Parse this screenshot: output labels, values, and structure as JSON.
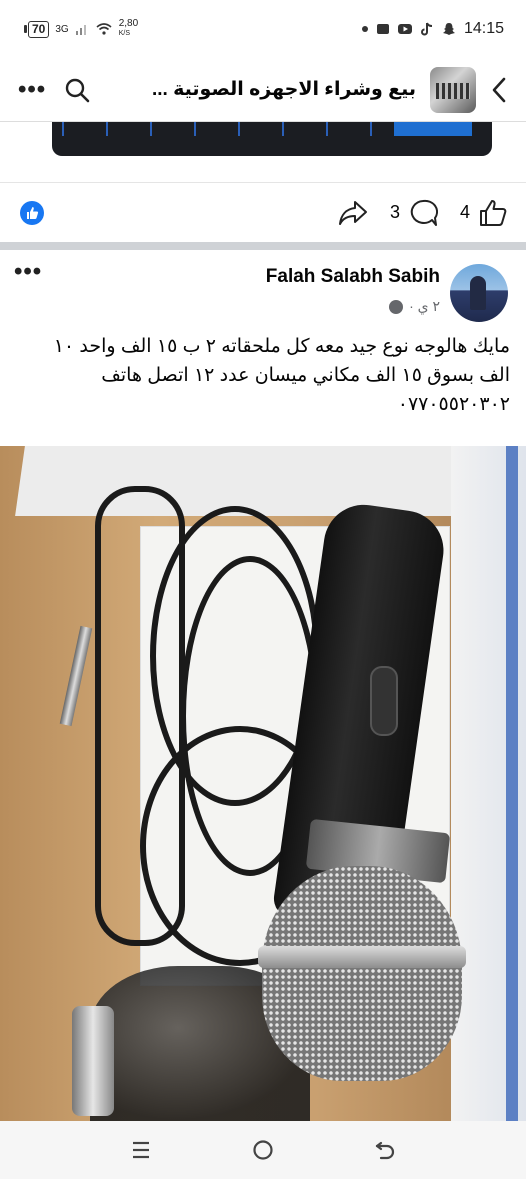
{
  "status_bar": {
    "battery": "70",
    "network": "3G",
    "speed_value": "2,80",
    "speed_unit": "K/S",
    "time": "14:15"
  },
  "header": {
    "title": "بيع وشراء الاجهزه الصوتية ..."
  },
  "actions": {
    "comments_count": "3",
    "likes_count": "4"
  },
  "post": {
    "author": "Falah Salabh Sabih",
    "time": "٢ ي ·",
    "text_line1": "مايك هالوجه نوع جيد معه كل ملحقاته ٢ ب ١٥ الف واحد ١٠",
    "text_line2": "الف بسوق ١٥ الف مكاني ميسان عدد ١٢ اتصل هاتف",
    "text_line3": "٠٧٧٠٥٥٢٠٣٠٢"
  },
  "colors": {
    "like_blue": "#1877f2",
    "meta_gray": "#65676b",
    "divider": "#cfd2d6"
  }
}
